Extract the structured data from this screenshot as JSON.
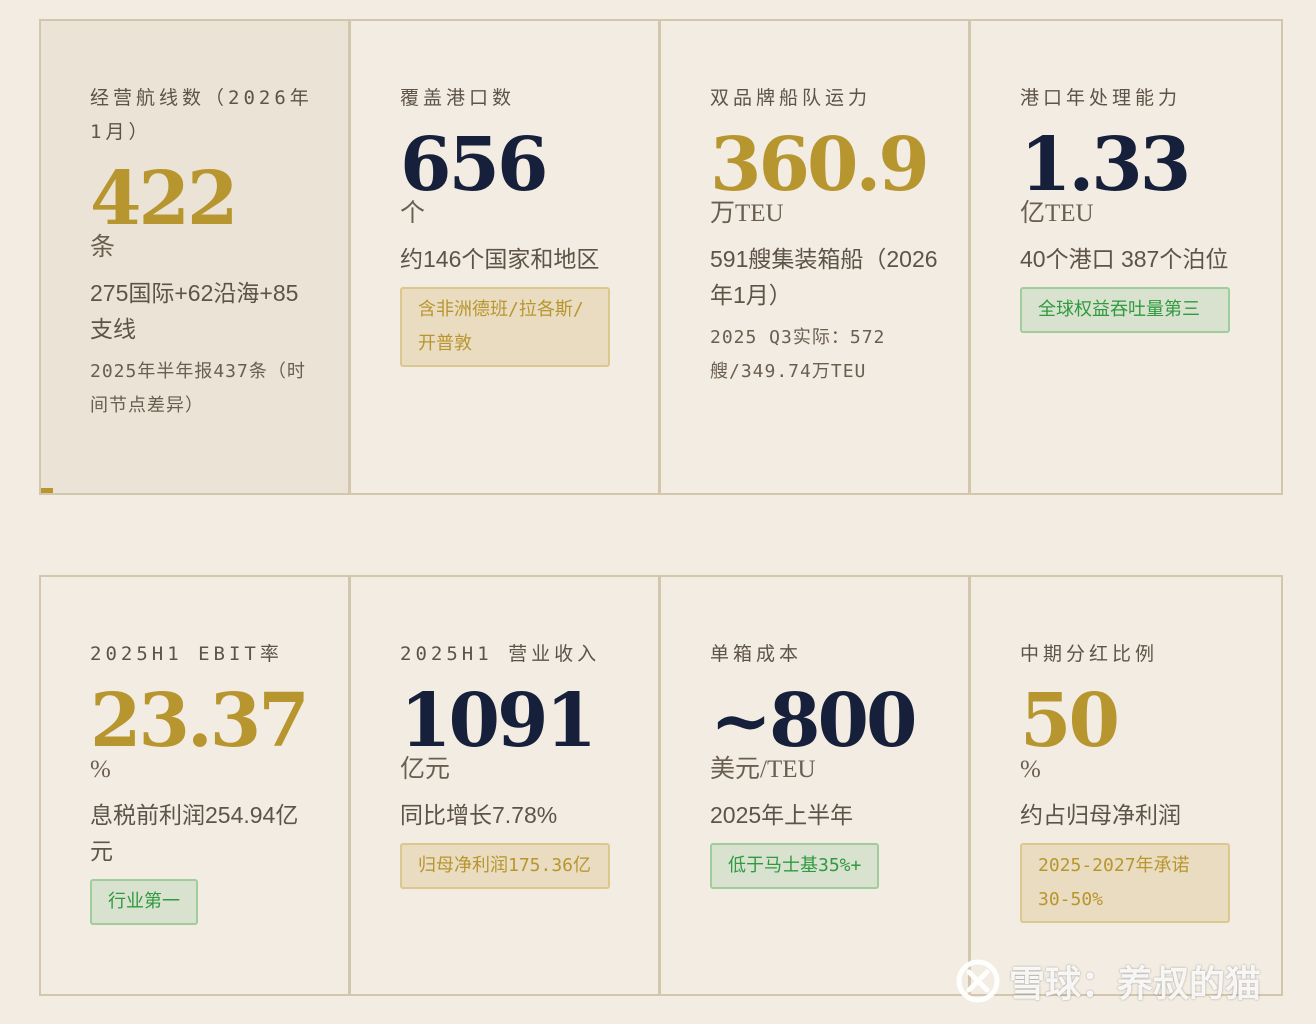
{
  "cards_row1": [
    {
      "label": "经营航线数（2026年1月）",
      "value": "422",
      "unit": "条",
      "desc": "275国际+62沿海+85支线",
      "note": "2025年半年报437条（时间节点差异）"
    },
    {
      "label": "覆盖港口数",
      "value": "656",
      "unit": "个",
      "desc": "约146个国家和地区",
      "badge": "含非洲德班/拉各斯/开普敦"
    },
    {
      "label": "双品牌船队运力",
      "value": "360.9",
      "unit": "万TEU",
      "desc": "591艘集装箱船（2026年1月）",
      "note": "2025 Q3实际：572艘/349.74万TEU"
    },
    {
      "label": "港口年处理能力",
      "value": "1.33",
      "unit": "亿TEU",
      "desc": "40个港口 387个泊位",
      "badge": "全球权益吞吐量第三"
    }
  ],
  "cards_row2": [
    {
      "label": "2025H1 EBIT率",
      "value": "23.37",
      "unit": "%",
      "desc": "息税前利润254.94亿元",
      "badge": "行业第一"
    },
    {
      "label": "2025H1 营业收入",
      "value": "1091",
      "unit": "亿元",
      "desc": "同比增长7.78%",
      "badge": "归母净利润175.36亿"
    },
    {
      "label": "单箱成本",
      "value": "~800",
      "unit": "美元/TEU",
      "desc": "2025年上半年",
      "badge": "低于马士基35%+"
    },
    {
      "label": "中期分红比例",
      "value": "50",
      "unit": "%",
      "desc": "约占归母净利润",
      "badge": "2025-2027年承诺30-50%"
    }
  ],
  "watermark": {
    "text": "雪球：养叔的猫",
    "icon": "xueqiu-logo-icon"
  },
  "colors": {
    "background": "#f3ece2",
    "gold": "#b8962f",
    "navy": "#17203a",
    "border": "#d2c7ad",
    "green": "#2f9a3f"
  }
}
